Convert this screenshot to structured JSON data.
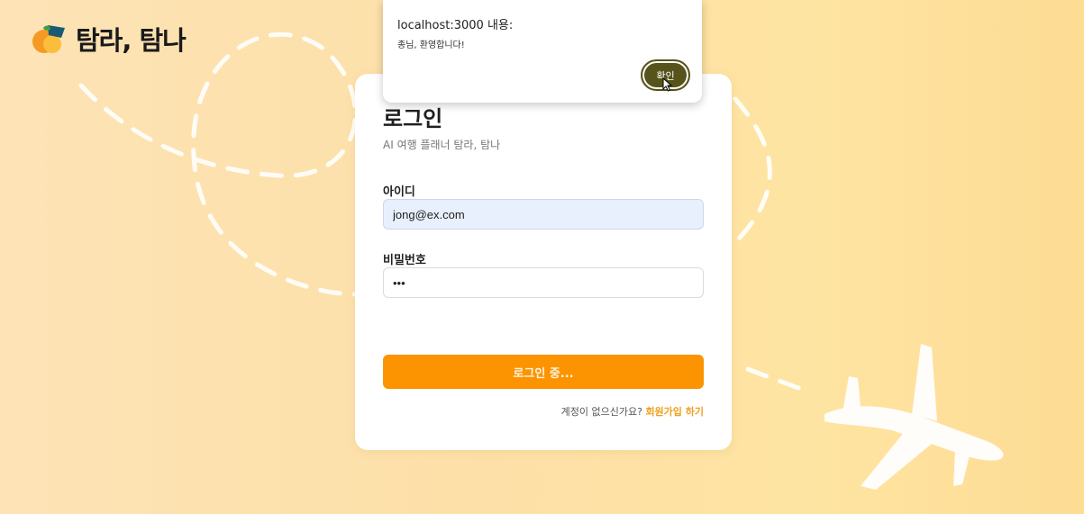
{
  "brand": {
    "name": "탐라, 탐나",
    "logo_icon": "tangerine-logo-icon"
  },
  "login": {
    "title": "로그인",
    "subtitle": "AI 여행 플래너 탐라, 탐나",
    "id_label": "아이디",
    "id_value": "jong@ex.com",
    "password_label": "비밀번호",
    "password_value": "•••",
    "submit_label": "로그인 중...",
    "signup_prompt": "계정이 없으신가요?",
    "signup_link": "회원가입 하기"
  },
  "alert": {
    "title": "localhost:3000 내용:",
    "message": "종님, 환영합니다!",
    "ok_label": "확인"
  },
  "colors": {
    "accent": "#fb9400",
    "link": "#f0a020",
    "dialog_button": "#56541a",
    "background": "#fde0a7"
  }
}
